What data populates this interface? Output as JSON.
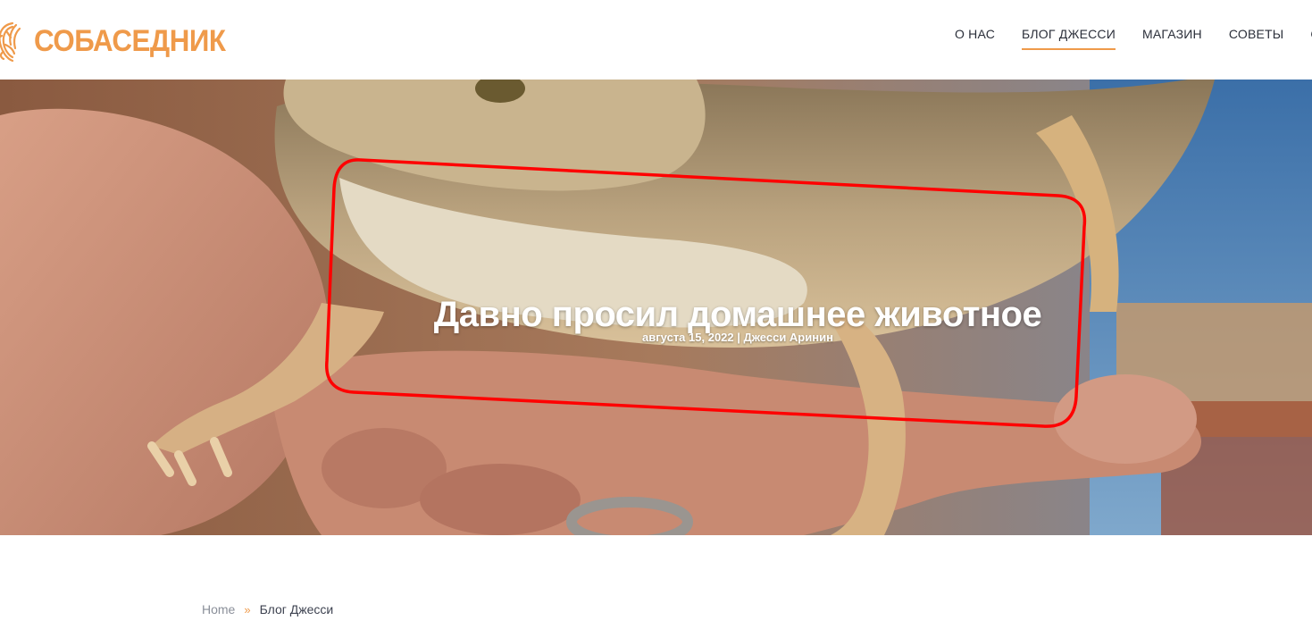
{
  "brand": {
    "name": "СОБАСЕДНИК",
    "color": "#ef9a4a",
    "icon": "lion-head-icon"
  },
  "nav": {
    "items": [
      {
        "label": "О НАС",
        "active": false
      },
      {
        "label": "БЛОГ ДЖЕССИ",
        "active": true
      },
      {
        "label": "МАГАЗИН",
        "active": false
      },
      {
        "label": "СОВЕТЫ",
        "active": false
      },
      {
        "label": "СТА",
        "active": false
      }
    ],
    "accent": "#ef9a4a"
  },
  "hero": {
    "title": "Давно просил домашнее животное",
    "meta": "августа 15, 2022 | Джесси Аринин",
    "image_subject": "bearded dragon lizard held in hands"
  },
  "breadcrumb": {
    "home": "Home",
    "separator": "»",
    "current": "Блог Джесси"
  },
  "annotation": {
    "color": "#ff0000"
  }
}
